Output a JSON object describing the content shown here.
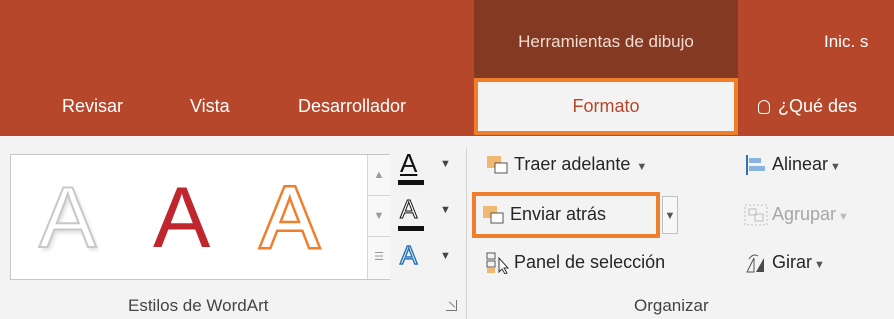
{
  "title_bar": {
    "context_group_title": "Herramientas de dibujo",
    "signin_text": "Inic. s"
  },
  "tabs": {
    "revisar": "Revisar",
    "vista": "Vista",
    "desarrollador": "Desarrollador",
    "formato": "Formato",
    "tell_me": "¿Qué des"
  },
  "wordart_group": {
    "label": "Estilos de WordArt",
    "styles": [
      "A",
      "A",
      "A"
    ],
    "text_fill_letter": "A",
    "text_outline_letter": "A",
    "text_effects_letter": "A"
  },
  "organize_group": {
    "label": "Organizar",
    "bring_forward": "Traer adelante",
    "send_backward": "Enviar atrás",
    "selection_pane": "Panel de selección",
    "align": "Alinear",
    "group": "Agrupar",
    "rotate": "Girar"
  },
  "colors": {
    "ribbon_accent": "#b7472a",
    "context_group": "#843a22",
    "highlight": "#ef7f2c",
    "wordart_red": "#c0262d"
  },
  "icons": [
    "text-fill-icon",
    "text-outline-icon",
    "text-effects-icon",
    "bring-forward-icon",
    "send-backward-icon",
    "selection-pane-icon",
    "align-icon",
    "group-icon",
    "rotate-icon",
    "lightbulb-icon"
  ]
}
